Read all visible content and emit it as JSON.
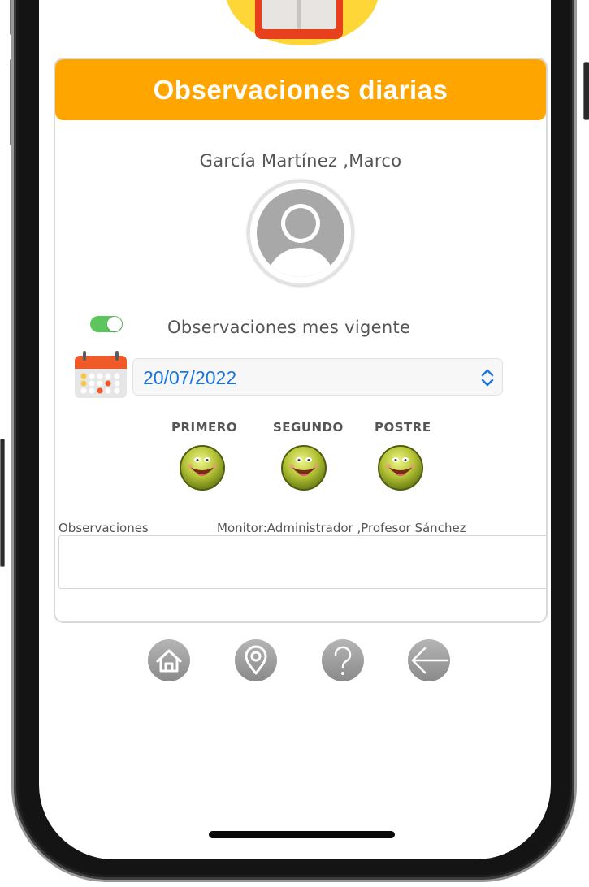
{
  "header": {
    "title": "Observaciones diarias"
  },
  "student": {
    "name": "García Martínez ,Marco"
  },
  "filter": {
    "toggle_label": "Observaciones mes vigente",
    "toggle_on": true
  },
  "date_select": {
    "value": "20/07/2022"
  },
  "meals": [
    {
      "label": "PRIMERO",
      "icon": "smiley-face-icon"
    },
    {
      "label": "SEGUNDO",
      "icon": "smiley-face-icon"
    },
    {
      "label": "POSTRE",
      "icon": "smiley-face-icon"
    }
  ],
  "observations": {
    "label": "Observaciones",
    "monitor": "Monitor:Administrador ,Profesor Sánchez",
    "value": ""
  },
  "nav": [
    {
      "icon": "home-icon"
    },
    {
      "icon": "location-pin-icon"
    },
    {
      "icon": "help-icon"
    },
    {
      "icon": "back-arrow-icon"
    }
  ],
  "colors": {
    "header": "#ffa500",
    "toggle_on": "#5dc55e",
    "date_text": "#1a74e0",
    "face": "#8ba01e"
  }
}
